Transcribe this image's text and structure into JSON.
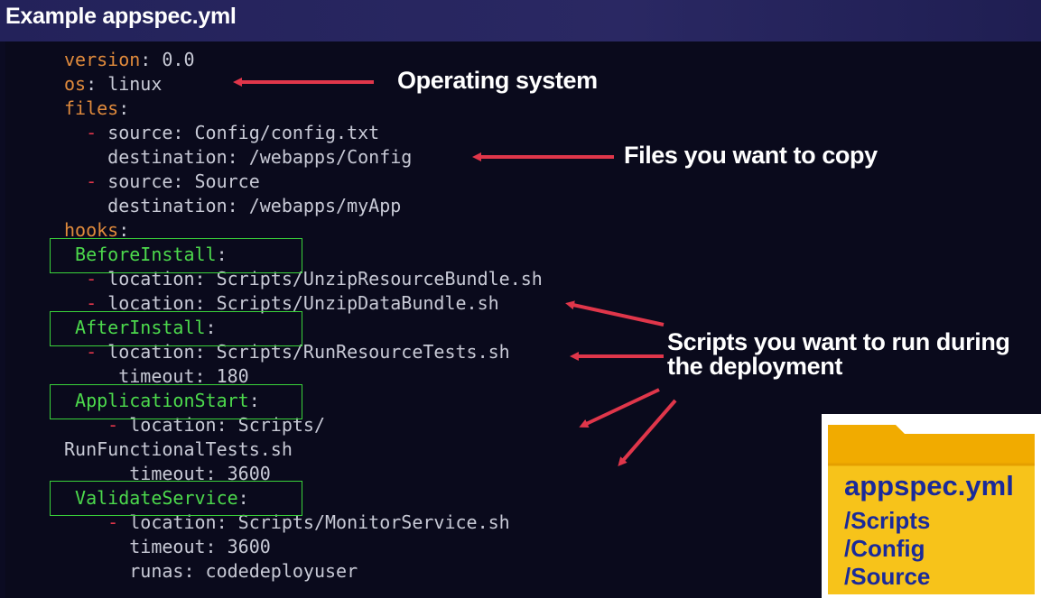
{
  "title": "Example appspec.yml",
  "code_lines": [
    {
      "key": "version",
      "sep": ": ",
      "value": "0.0",
      "indent": "",
      "type": "top"
    },
    {
      "key": "os",
      "sep": ": ",
      "value": "linux",
      "indent": "",
      "type": "top"
    },
    {
      "key": "files",
      "sep": ":",
      "value": "",
      "indent": "",
      "type": "top"
    },
    {
      "indent": "  ",
      "dash": "- ",
      "rest": "source: Config/config.txt",
      "type": "item"
    },
    {
      "indent": "    ",
      "rest": "destination: /webapps/Config",
      "type": "plain"
    },
    {
      "indent": "  ",
      "dash": "- ",
      "rest": "source: Source",
      "type": "item"
    },
    {
      "indent": "    ",
      "rest": "destination: /webapps/myApp",
      "type": "plain"
    },
    {
      "key": "hooks",
      "sep": ":",
      "value": "",
      "indent": "",
      "type": "top"
    },
    {
      "indent": " ",
      "hook": "BeforeInstall",
      "sep": ":",
      "type": "hook"
    },
    {
      "indent": "  ",
      "dash": "- ",
      "rest": "location: Scripts/UnzipResourceBundle.sh",
      "type": "item"
    },
    {
      "indent": "  ",
      "dash": "- ",
      "rest": "location: Scripts/UnzipDataBundle.sh",
      "type": "item"
    },
    {
      "indent": " ",
      "hook": "AfterInstall",
      "sep": ":",
      "type": "hook"
    },
    {
      "indent": "  ",
      "dash": "- ",
      "rest": "location: Scripts/RunResourceTests.sh",
      "type": "item"
    },
    {
      "indent": "     ",
      "rest": "timeout: 180",
      "type": "plain"
    },
    {
      "indent": " ",
      "hook": "ApplicationStart",
      "sep": ":",
      "type": "hook"
    },
    {
      "indent": "    ",
      "dash": "- ",
      "rest": "location: Scripts/",
      "type": "item"
    },
    {
      "indent": "",
      "rest": "RunFunctionalTests.sh",
      "type": "plain"
    },
    {
      "indent": "      ",
      "rest": "timeout: 3600",
      "type": "plain"
    },
    {
      "indent": " ",
      "hook": "ValidateService",
      "sep": ":",
      "type": "hook"
    },
    {
      "indent": "    ",
      "dash": "- ",
      "rest": "location: Scripts/MonitorService.sh",
      "type": "item"
    },
    {
      "indent": "      ",
      "rest": "timeout: 3600",
      "type": "plain"
    },
    {
      "indent": "      ",
      "rest": "runas: codedeployuser",
      "type": "plain"
    }
  ],
  "callouts": {
    "os": "Operating system",
    "files": "Files you want to copy",
    "scripts_line1": "Scripts you want to run during",
    "scripts_line2": "the deployment"
  },
  "folder": {
    "filename": "appspec.yml",
    "items": [
      "/Scripts",
      "/Config",
      "/Source"
    ]
  },
  "colors": {
    "key": "#e08a3c",
    "dash": "#e0364a",
    "hook": "#4cd94c",
    "text": "#c8cad6",
    "arrow": "#e0364a",
    "folder_yellow": "#f5c200",
    "folder_text": "#1a2a9a"
  }
}
